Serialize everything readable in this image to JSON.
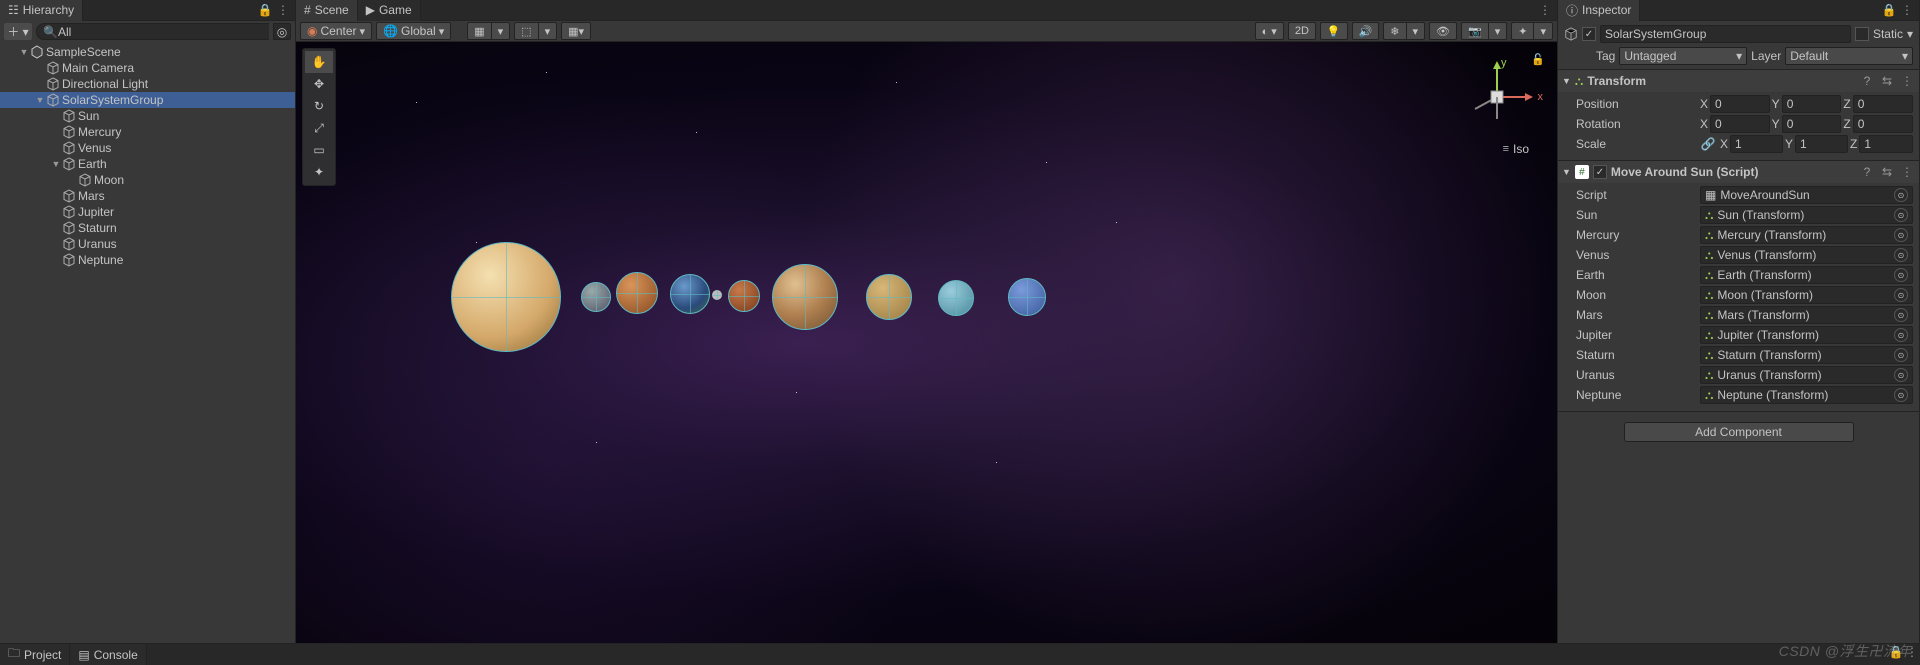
{
  "hierarchy": {
    "tab": "Hierarchy",
    "search_placeholder": "All",
    "tree": [
      {
        "name": "SampleScene",
        "depth": 1,
        "icon": "unity",
        "expanded": true
      },
      {
        "name": "Main Camera",
        "depth": 2,
        "icon": "cube"
      },
      {
        "name": "Directional Light",
        "depth": 2,
        "icon": "cube"
      },
      {
        "name": "SolarSystemGroup",
        "depth": 2,
        "icon": "cube",
        "expanded": true,
        "selected": true
      },
      {
        "name": "Sun",
        "depth": 3,
        "icon": "cube"
      },
      {
        "name": "Mercury",
        "depth": 3,
        "icon": "cube"
      },
      {
        "name": "Venus",
        "depth": 3,
        "icon": "cube"
      },
      {
        "name": "Earth",
        "depth": 3,
        "icon": "cube",
        "expanded": true
      },
      {
        "name": "Moon",
        "depth": 4,
        "icon": "cube"
      },
      {
        "name": "Mars",
        "depth": 3,
        "icon": "cube"
      },
      {
        "name": "Jupiter",
        "depth": 3,
        "icon": "cube"
      },
      {
        "name": "Staturn",
        "depth": 3,
        "icon": "cube"
      },
      {
        "name": "Uranus",
        "depth": 3,
        "icon": "cube"
      },
      {
        "name": "Neptune",
        "depth": 3,
        "icon": "cube"
      }
    ]
  },
  "scene": {
    "tab_scene": "Scene",
    "tab_game": "Game",
    "pivot": "Center",
    "handle": "Global",
    "btn_2d": "2D",
    "iso": "Iso",
    "axes": {
      "x": "x",
      "y": "y"
    }
  },
  "inspector": {
    "tab": "Inspector",
    "name": "SolarSystemGroup",
    "static_label": "Static",
    "tag_label": "Tag",
    "tag_value": "Untagged",
    "layer_label": "Layer",
    "layer_value": "Default",
    "transform": {
      "title": "Transform",
      "position_label": "Position",
      "rotation_label": "Rotation",
      "scale_label": "Scale",
      "pos": {
        "x": "0",
        "y": "0",
        "z": "0"
      },
      "rot": {
        "x": "0",
        "y": "0",
        "z": "0"
      },
      "scale": {
        "x": "1",
        "y": "1",
        "z": "1"
      }
    },
    "script_comp": {
      "title": "Move Around Sun (Script)",
      "script_label": "Script",
      "script_value": "MoveAroundSun",
      "refs": [
        {
          "label": "Sun",
          "value": "Sun (Transform)"
        },
        {
          "label": "Mercury",
          "value": "Mercury (Transform)"
        },
        {
          "label": "Venus",
          "value": "Venus (Transform)"
        },
        {
          "label": "Earth",
          "value": "Earth (Transform)"
        },
        {
          "label": "Moon",
          "value": "Moon (Transform)"
        },
        {
          "label": "Mars",
          "value": "Mars (Transform)"
        },
        {
          "label": "Jupiter",
          "value": "Jupiter (Transform)"
        },
        {
          "label": "Staturn",
          "value": "Staturn (Transform)"
        },
        {
          "label": "Uranus",
          "value": "Uranus (Transform)"
        },
        {
          "label": "Neptune",
          "value": "Neptune (Transform)"
        }
      ]
    },
    "add_component": "Add Component"
  },
  "bottom": {
    "project": "Project",
    "console": "Console"
  },
  "watermark": "CSDN @浮生卍流年"
}
